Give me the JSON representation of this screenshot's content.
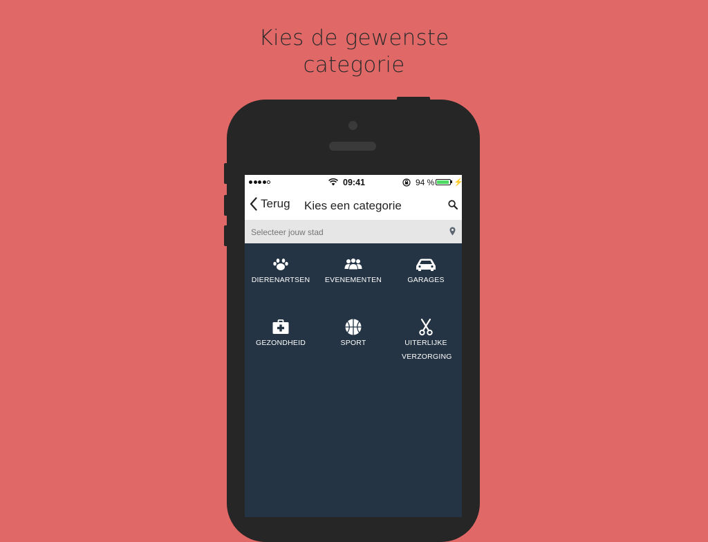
{
  "headline": {
    "line1": "Kies de gewenste",
    "line2": "categorie"
  },
  "status_bar": {
    "time": "09:41",
    "battery": "94 %"
  },
  "nav": {
    "back_label": "Terug",
    "title": "Kies een categorie"
  },
  "city": {
    "placeholder": "Selecteer jouw stad"
  },
  "categories": [
    {
      "label": "DIERENARTSEN",
      "icon": "paw-icon"
    },
    {
      "label": "EVENEMENTEN",
      "icon": "people-icon"
    },
    {
      "label": "GARAGES",
      "icon": "car-icon"
    },
    {
      "label": "GEZONDHEID",
      "icon": "medkit-icon"
    },
    {
      "label": "SPORT",
      "icon": "basketball-icon"
    },
    {
      "label": "UITERLIJKE VERZORGING",
      "icon": "scissors-icon"
    }
  ],
  "colors": {
    "background": "#e06867",
    "screen": "#243444",
    "battery": "#4cd964"
  }
}
